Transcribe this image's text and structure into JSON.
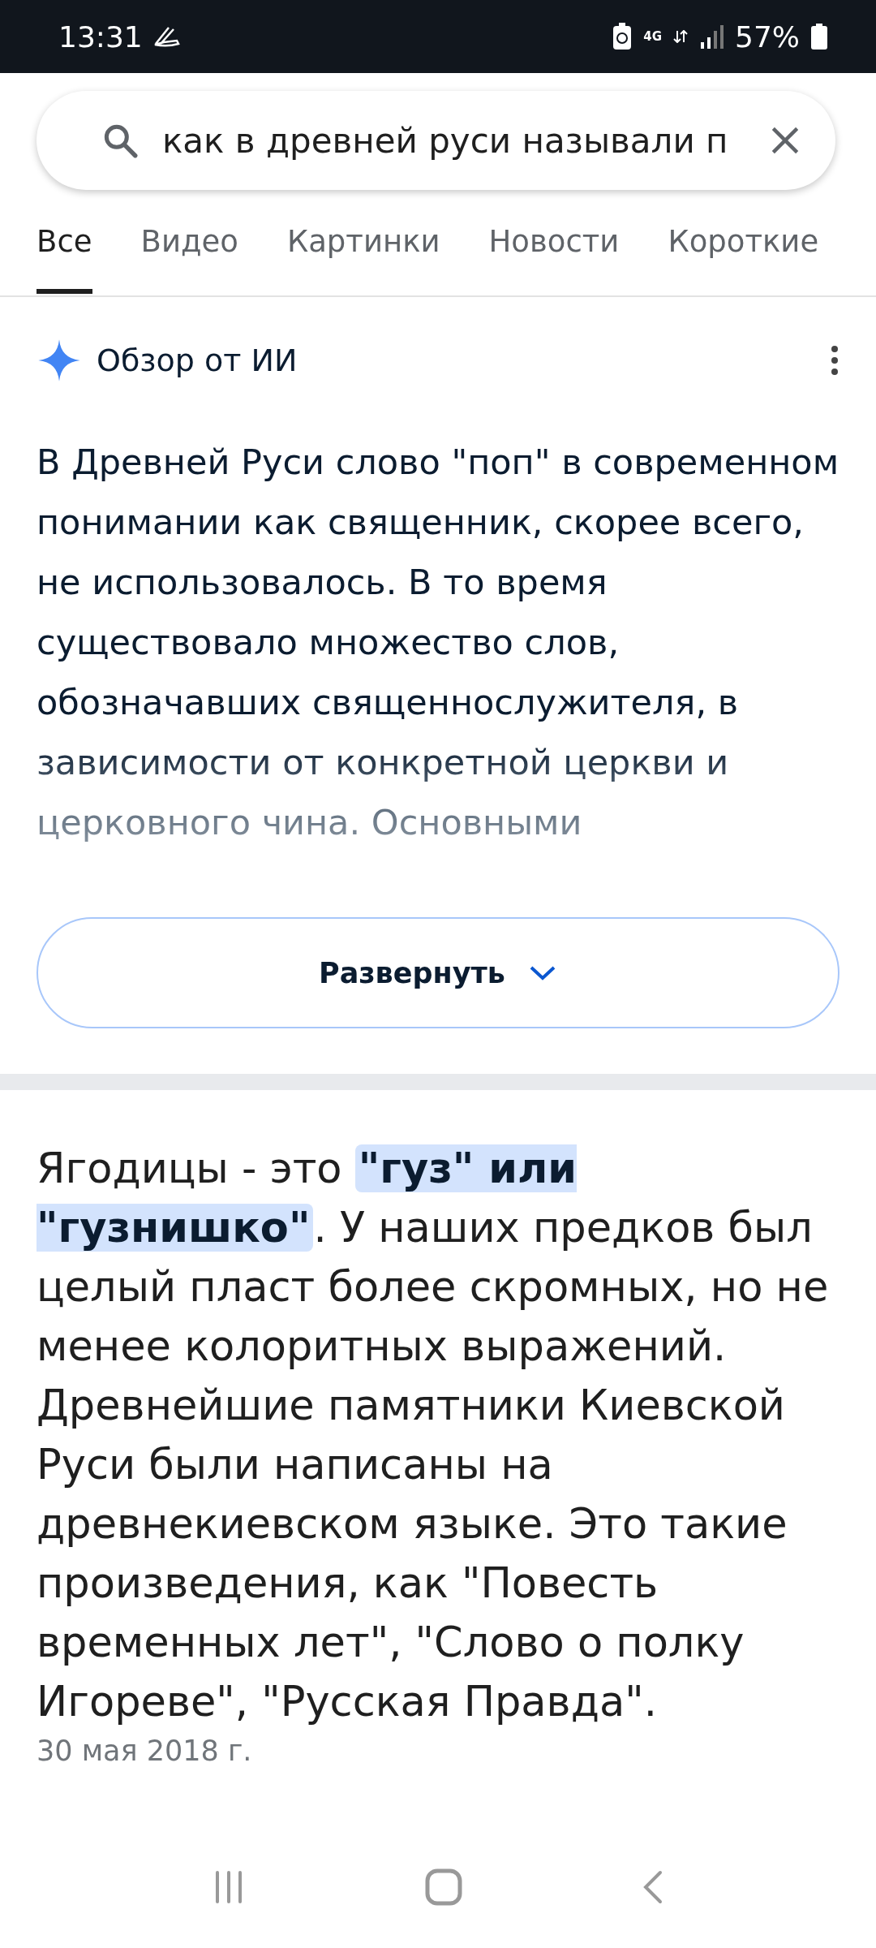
{
  "status_bar": {
    "time": "13:31",
    "battery": "57%",
    "network": "4G"
  },
  "search": {
    "value": "как в древней руси называли п"
  },
  "tabs": [
    {
      "label": "Все",
      "selected": true
    },
    {
      "label": "Видео",
      "selected": false
    },
    {
      "label": "Картинки",
      "selected": false
    },
    {
      "label": "Новости",
      "selected": false
    },
    {
      "label": "Короткие",
      "selected": false
    }
  ],
  "ai_overview": {
    "title": "Обзор от ИИ",
    "text": "В Древней Руси слово \"поп\" в современном понимании как священник, скорее всего, не использовалось. В то время существовало множество слов, обозначавших священнослужителя, в зависимости от конкретной церкви и церковного чина. Основными",
    "expand_button": "Развернуть"
  },
  "snippet": {
    "text": "Ягодицы - это **\"гуз\" или \"гузнишко\"**. У наших предков был целый пласт более скромных, но не менее колоритных выражений. Древнейшие памятники Киевской Руси были написаны на древнекиевском языке. Это такие произведения, как \"Повесть временных лет\", \"Слово о полку Игореве\", \"Русская Правда\".",
    "date": "30 мая 2018 г."
  }
}
